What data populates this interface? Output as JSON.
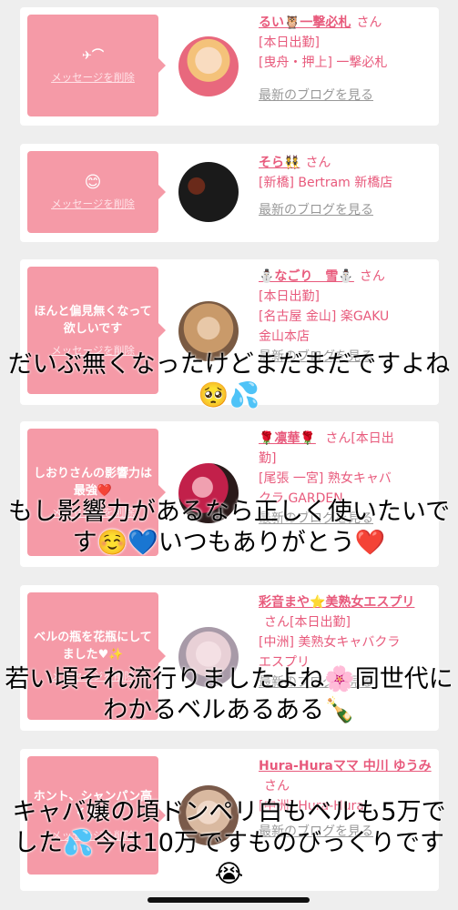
{
  "delete_label": "メッセージを削除",
  "san_label": "さん",
  "blog_label": "最新のブログを見る",
  "cards": [
    {
      "message": "✈⌒",
      "name": "るい🦉一撃必札",
      "lines": [
        "[本日出勤]",
        "[曳舟・押上] 一撃必札"
      ],
      "avatar_colors": [
        "#f4c27a",
        "#e8687d"
      ]
    },
    {
      "message": "😊",
      "name": "そら👯",
      "lines": [
        "[新橋] Bertram 新橋店"
      ],
      "avatar_colors": [
        "#1a1a1a",
        "#5a2a20"
      ]
    },
    {
      "message": "ほんと偏見無くなって欲しいです",
      "name": "⛄なごり　雪⛄",
      "lines": [
        "[本日出勤]",
        "[名古屋 金山] 楽GAKU",
        "金山本店"
      ],
      "avatar_colors": [
        "#c99a6a",
        "#7a5a42"
      ]
    },
    {
      "message": "しおりさんの影響力は最強❤️",
      "name": "🌹凛華🌹",
      "lines": [
        "さん[本日出",
        "勤]",
        "[尾張 一宮] 熟女キャバ",
        "クラ GARDEN"
      ],
      "avatar_colors": [
        "#c2204a",
        "#2a1a1a"
      ]
    },
    {
      "message": "ベルの瓶を花瓶にしてました♥✨",
      "name": "彩音まや⭐美熟女エスプリ",
      "lines": [
        "[中洲] 美熟女キャバクラ",
        "エスプリ"
      ],
      "san_inline": "さん[本日出勤]",
      "avatar_colors": [
        "#e8d0d6",
        "#a89aa8"
      ]
    },
    {
      "message": "ホント、シャンパン高くな…",
      "name": "Hura-Huraママ 中川 ゆうみ",
      "lines": [
        "[中洲] Hura-Hura"
      ],
      "avatar_colors": [
        "#d9b9a0",
        "#7a5a4a"
      ]
    }
  ],
  "overlay_texts": [
    "だいぶ無くなったけどまだまだですよね🥺💦",
    "もし影響力があるなら正しく使いたいです☺️💙いつもありがとう❤️",
    "若い頃それ流行りましたよね🌸同世代にわかるベルあるある🍾",
    "キャバ嬢の頃ドンペリ白もベルも5万でした💦今は10万ですものびっくりです😭"
  ]
}
